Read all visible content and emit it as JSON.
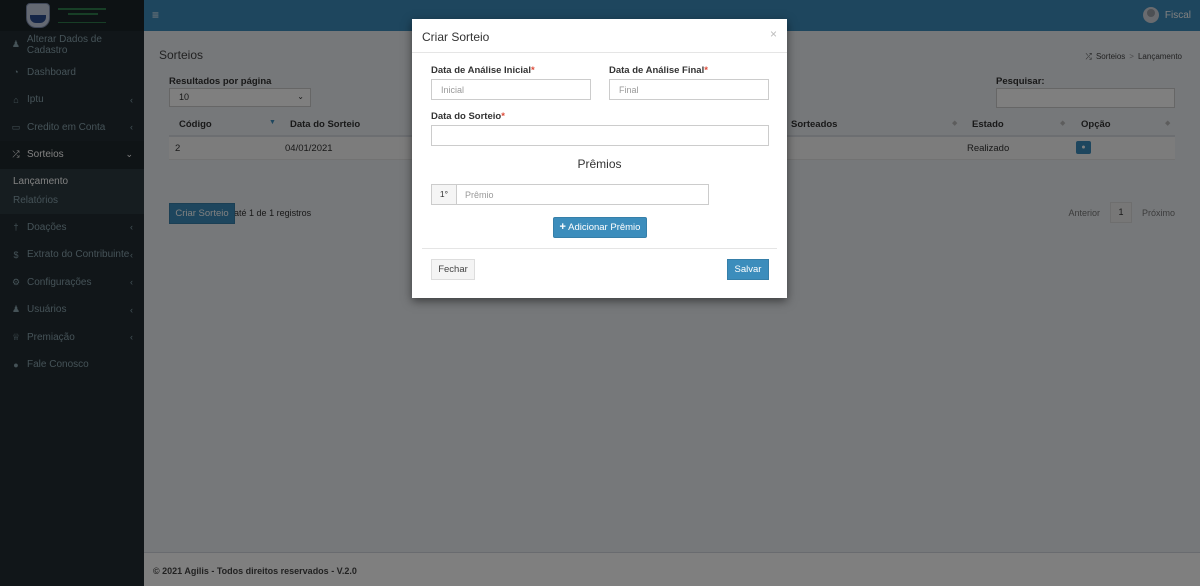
{
  "sidebar": {
    "items": [
      {
        "icon": "user-icon",
        "glyph": "♟",
        "label": "Alterar Dados de Cadastro",
        "chevron": false
      },
      {
        "icon": "dashboard-icon",
        "glyph": "◔",
        "label": "Dashboard",
        "chevron": false
      },
      {
        "icon": "home-icon",
        "glyph": "⌂",
        "label": "Iptu",
        "chevron": true
      },
      {
        "icon": "credit-card-icon",
        "glyph": "▭",
        "label": "Credito em Conta",
        "chevron": true
      },
      {
        "icon": "shuffle-icon",
        "glyph": "⤮",
        "label": "Sorteios",
        "chevron": true
      },
      {
        "icon": "gift-icon",
        "glyph": "†",
        "label": "Doações",
        "chevron": true
      },
      {
        "icon": "dollar-icon",
        "glyph": "$",
        "label": "Extrato do Contribuinte",
        "chevron": true
      },
      {
        "icon": "gear-icon",
        "glyph": "⚙",
        "label": "Configurações",
        "chevron": true
      },
      {
        "icon": "users-icon",
        "glyph": "♟",
        "label": "Usuários",
        "chevron": true
      },
      {
        "icon": "trophy-icon",
        "glyph": "♕",
        "label": "Premiação",
        "chevron": true
      },
      {
        "icon": "chat-icon",
        "glyph": "●",
        "label": "Fale Conosco",
        "chevron": false
      }
    ],
    "submenu": [
      "Lançamento",
      "Relatórios"
    ],
    "chevron_glyph": "‹",
    "chevron_down_glyph": "⌄"
  },
  "topbar": {
    "menu_glyph": "≡",
    "user_name": "Fiscal"
  },
  "page": {
    "title": "Sorteios",
    "breadcrumb": [
      "Sorteios",
      "Lançamento"
    ],
    "breadcrumb_icon": "⤮"
  },
  "table_controls": {
    "results_per_page_label": "Resultados por página",
    "results_per_page_value": "10",
    "search_label": "Pesquisar:"
  },
  "table": {
    "headers": [
      "Código",
      "Data do Sorteio",
      "Sorteados",
      "Estado",
      "Opção"
    ],
    "rows": [
      {
        "codigo": "2",
        "data": "04/01/2021",
        "estado": "Realizado"
      }
    ],
    "showing": "Mostrando de 1 até 1 de 1 registros",
    "pager": {
      "prev": "Anterior",
      "page": "1",
      "next": "Próximo"
    }
  },
  "create_button": "Criar Sorteio",
  "footer": "© 2021 Agilis - Todos direitos reservados - V.2.0",
  "modal": {
    "title": "Criar Sorteio",
    "close_glyph": "×",
    "start_label": "Data de Análise Inicial",
    "start_placeholder": "Inicial",
    "end_label": "Data de Análise Final",
    "end_placeholder": "Final",
    "draw_date_label": "Data do Sorteio",
    "required_mark": "*",
    "prizes_title": "Prêmios",
    "prize_index": "1°",
    "prize_placeholder": "Prêmio",
    "add_prize": "Adicionar Prêmio",
    "close_button": "Fechar",
    "save_button": "Salvar"
  },
  "colors": {
    "primary": "#3c8dbc",
    "sidebar": "#222d32",
    "required": "#dd4b39"
  }
}
